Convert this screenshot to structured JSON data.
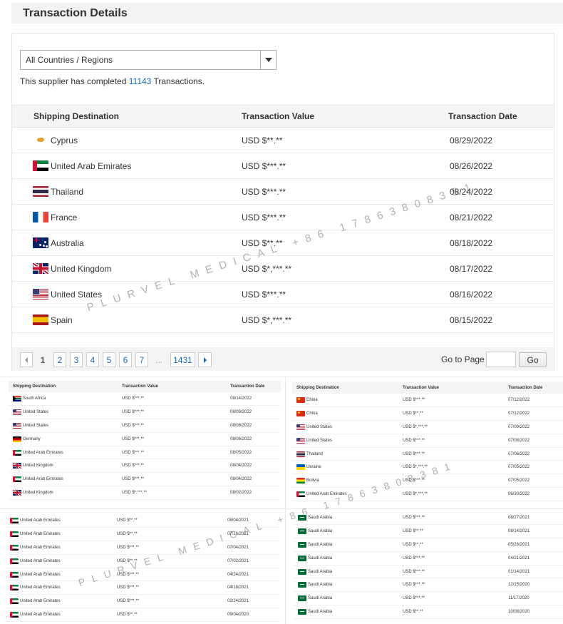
{
  "header": {
    "title": "Transaction Details"
  },
  "filter": {
    "selected": "All Countries / Regions"
  },
  "summary": {
    "prefix": "This supplier has completed",
    "count": "11143",
    "suffix": "Transactions."
  },
  "columns": {
    "destination": "Shipping Destination",
    "value": "Transaction Value",
    "date": "Transaction Date"
  },
  "rows": [
    {
      "country": "Cyprus",
      "flag": "cyprus-flag-icon",
      "value": "USD $**.**",
      "date": "08/29/2022"
    },
    {
      "country": "United Arab Emirates",
      "flag": "uae-flag-icon",
      "value": "USD $***.**",
      "date": "08/26/2022"
    },
    {
      "country": "Thailand",
      "flag": "thailand-flag-icon",
      "value": "USD $***.**",
      "date": "08/24/2022"
    },
    {
      "country": "France",
      "flag": "france-flag-icon",
      "value": "USD $***.**",
      "date": "08/21/2022"
    },
    {
      "country": "Australia",
      "flag": "australia-flag-icon",
      "value": "USD $**.**",
      "date": "08/18/2022"
    },
    {
      "country": "United Kingdom",
      "flag": "uk-flag-icon",
      "value": "USD $*,***.**",
      "date": "08/17/2022"
    },
    {
      "country": "United States",
      "flag": "usa-flag-icon",
      "value": "USD $***.**",
      "date": "08/16/2022"
    },
    {
      "country": "Spain",
      "flag": "spain-flag-icon",
      "value": "USD $*,***.**",
      "date": "08/15/2022"
    }
  ],
  "pagination": {
    "current": "1",
    "pages": [
      "2",
      "3",
      "4",
      "5",
      "6",
      "7"
    ],
    "ellipsis": "...",
    "last": "1431",
    "goto_label": "Go to Page",
    "go_button": "Go"
  },
  "watermark": "PLURVEL MEDICAL +86 17863808381",
  "mini_tables": {
    "top_left": {
      "headers": [
        "Shipping Destination",
        "Transaction Value",
        "Transaction Date"
      ],
      "rows": [
        [
          "South Africa",
          "USD $***.**",
          "08/14/2022"
        ],
        [
          "United States",
          "USD $***.**",
          "08/09/2022"
        ],
        [
          "United States",
          "USD $***.**",
          "08/08/2022"
        ],
        [
          "Germany",
          "USD $***.**",
          "08/06/2022"
        ],
        [
          "United Arab Emirates",
          "USD $***.**",
          "08/05/2022"
        ],
        [
          "United Kingdom",
          "USD $***.**",
          "08/04/2022"
        ],
        [
          "United Arab Emirates",
          "USD $***.**",
          "08/04/2022"
        ],
        [
          "United Kingdom",
          "USD $*,***.**",
          "08/02/2022"
        ]
      ]
    },
    "top_right": {
      "headers": [
        "Shipping Destination",
        "Transaction Value",
        "Transaction Date"
      ],
      "rows": [
        [
          "China",
          "USD $***.**",
          "07/12/2022"
        ],
        [
          "China",
          "USD $**.**",
          "07/12/2022"
        ],
        [
          "United States",
          "USD $*,***.**",
          "07/09/2022"
        ],
        [
          "United States",
          "USD $***.**",
          "07/08/2022"
        ],
        [
          "Thailand",
          "USD $***.**",
          "07/06/2022"
        ],
        [
          "Ukraine",
          "USD $*,***.**",
          "07/05/2022"
        ],
        [
          "Bolivia",
          "USD $***.**",
          "07/05/2022"
        ],
        [
          "United Arab Emirates",
          "USD $*,***.**",
          "06/30/2022"
        ]
      ]
    },
    "bottom_left": {
      "rows": [
        [
          "United Arab Emirates",
          "USD $**.**",
          "08/04/2021"
        ],
        [
          "United Arab Emirates",
          "USD $**.**",
          "07/16/2021"
        ],
        [
          "United Arab Emirates",
          "USD $***.**",
          "07/04/2021"
        ],
        [
          "United Arab Emirates",
          "USD $**.**",
          "07/02/2021"
        ],
        [
          "United Arab Emirates",
          "USD $***.**",
          "04/24/2021"
        ],
        [
          "United Arab Emirates",
          "USD $***.**",
          "04/18/2021"
        ],
        [
          "United Arab Emirates",
          "USD $***.**",
          "02/24/2021"
        ],
        [
          "United Arab Emirates",
          "USD $**.**",
          "09/04/2020"
        ]
      ]
    },
    "bottom_right": {
      "rows": [
        [
          "Saudi Arabia",
          "USD $***.**",
          "08/27/2021"
        ],
        [
          "Saudi Arabia",
          "USD $**.**",
          "08/14/2021"
        ],
        [
          "Saudi Arabia",
          "USD $**.**",
          "05/26/2021"
        ],
        [
          "Saudi Arabia",
          "USD $***.**",
          "04/21/2021"
        ],
        [
          "Saudi Arabia",
          "USD $***.**",
          "01/14/2021"
        ],
        [
          "Saudi Arabia",
          "USD $***.**",
          "12/15/2020"
        ],
        [
          "Saudi Arabia",
          "USD $***.**",
          "11/17/2020"
        ],
        [
          "Saudi Arabia",
          "USD $**.**",
          "10/08/2020"
        ]
      ]
    }
  }
}
